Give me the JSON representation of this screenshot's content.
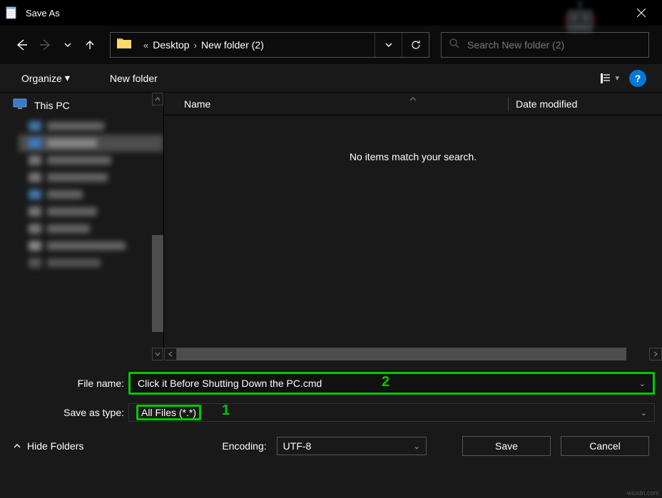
{
  "titlebar": {
    "title": "Save As"
  },
  "nav": {
    "breadcrumb": [
      "Desktop",
      "New folder (2)"
    ],
    "search_placeholder": "Search New folder (2)"
  },
  "toolbar": {
    "organize": "Organize",
    "new_folder": "New folder",
    "help": "?"
  },
  "sidebar": {
    "this_pc": "This PC"
  },
  "columns": {
    "name": "Name",
    "date": "Date modified"
  },
  "filearea": {
    "empty": "No items match your search."
  },
  "form": {
    "filename_label": "File name:",
    "filename_value": "Click it Before Shutting Down the PC.cmd",
    "filetype_label": "Save as type:",
    "filetype_value": "All Files  (*.*)",
    "annotation_1": "1",
    "annotation_2": "2"
  },
  "footer": {
    "hide_folders": "Hide Folders",
    "encoding_label": "Encoding:",
    "encoding_value": "UTF-8",
    "save": "Save",
    "cancel": "Cancel"
  },
  "watermark": "wsxdn.com"
}
